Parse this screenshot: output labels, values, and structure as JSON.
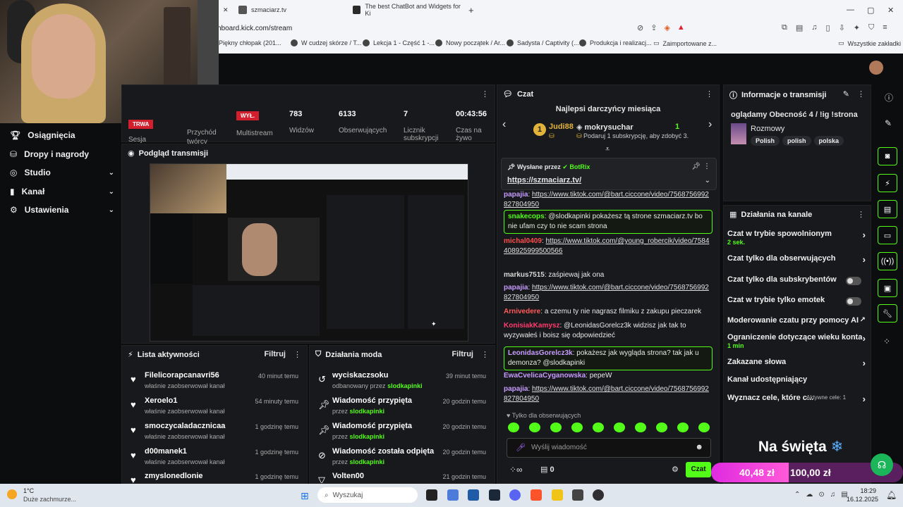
{
  "browser": {
    "tabs": [
      {
        "title": "szmaciarz.tv"
      },
      {
        "title": "The best ChatBot and Widgets for Ki"
      }
    ],
    "url": "hboard.kick.com/stream",
    "bookmarks": [
      "Piękny chłopak (201...",
      "W cudzej skórze / T...",
      "Lekcja 1 - Część 1 -...",
      "Nowy początek / Ar...",
      "Sadysta / Captivity (...",
      "Produkcja i realizacj...",
      "Zaimportowane z...",
      "Wszystkie zakładki"
    ]
  },
  "sidenav": {
    "items": [
      {
        "label": "Osiągnięcia",
        "icon": "trophy-icon"
      },
      {
        "label": "Dropy i nagrody",
        "icon": "gift-icon"
      },
      {
        "label": "Studio",
        "icon": "studio-icon",
        "chevron": "⌄"
      },
      {
        "label": "Kanał",
        "icon": "channel-icon",
        "chevron": "⌄"
      },
      {
        "label": "Ustawienia",
        "icon": "gear-icon",
        "chevron": "⌄"
      }
    ]
  },
  "stats": {
    "live_badge": "TRWA",
    "session_label": "Sesja",
    "revenue_label": "Przychód twórcy",
    "multistream_badge": "WYŁ.",
    "multistream_label": "Multistream",
    "viewers_value": "783",
    "viewers_label": "Widzów",
    "followers_value": "6133",
    "followers_label": "Obserwujących",
    "subs_value": "7",
    "subs_label": "Licznik subskrypcji",
    "time_value": "00:43:56",
    "time_label": "Czas na żywo"
  },
  "preview": {
    "title": "Podgląd transmisji"
  },
  "activity": {
    "title": "Lista aktywności",
    "filter": "Filtruj",
    "items": [
      {
        "name": "Filelicorapcanavri56",
        "desc": "właśnie zaobserwował kanał",
        "time": "40 minut temu"
      },
      {
        "name": "Xeroelo1",
        "desc": "właśnie zaobserwował kanał",
        "time": "54 minuty temu"
      },
      {
        "name": "smoczycaladacznicaa",
        "desc": "właśnie zaobserwował kanał",
        "time": "1 godzinę temu"
      },
      {
        "name": "d00manek1",
        "desc": "właśnie zaobserwował kanał",
        "time": "1 godzinę temu"
      },
      {
        "name": "zmyslonedlonie",
        "desc": "",
        "time": "1 godzinę temu"
      }
    ]
  },
  "modactions": {
    "title": "Działania moda",
    "filter": "Filtruj",
    "items": [
      {
        "name": "wyciskaczsoku",
        "pre": "odbanowany przez",
        "by": "slodkapinki",
        "time": "39 minut temu",
        "icon": "unban-icon"
      },
      {
        "name": "Wiadomość przypięta",
        "pre": "przez",
        "by": "slodkapinki",
        "time": "20 godzin temu",
        "icon": "pin-icon"
      },
      {
        "name": "Wiadomość przypięta",
        "pre": "przez",
        "by": "slodkapinki",
        "time": "20 godzin temu",
        "icon": "pin-icon"
      },
      {
        "name": "Wiadomość została odpięta",
        "pre": "przez",
        "by": "slodkapinki",
        "time": "20 godzin temu",
        "icon": "unpin-icon"
      },
      {
        "name": "Volten00",
        "pre": "",
        "by": "",
        "time": "21 godzin temu",
        "icon": "filter-icon"
      }
    ]
  },
  "chat": {
    "title": "Czat",
    "donors_title": "Najlepsi darczyńcy miesiąca",
    "donor1": "Judi88",
    "donor1_rank": "1",
    "donor2": "mokrysuchar",
    "donor2_count": "1",
    "donor2_sub": "Podaruj 1 subskrypcję, aby zdobyć 3.",
    "pinned_label": "Wysłane przez",
    "pinned_by": "BotRix",
    "pinned_link": "https://szmaciarz.tv/",
    "messages": [
      {
        "user": "papajia",
        "color": "#c79cff",
        "text": "https://www.tiktok.com/@bart.ciccone/video/7568756992827804950",
        "link": true
      },
      {
        "user": "snakecops",
        "color": "#53fc18",
        "text": "@slodkapinki pokażesz tą strone szmaciarz.tv bo nie ufam czy to nie scam strona",
        "hl": true
      },
      {
        "user": "michal0409",
        "color": "#ff4d4d",
        "text": "https://www.tiktok.com/@young_robercik/video/7584408925999500566",
        "link": true
      },
      {
        "user": "markus7515",
        "color": "#d8d8d8",
        "text": "zaśpiewaj jak ona"
      },
      {
        "user": "papajia",
        "color": "#c79cff",
        "text": "https://www.tiktok.com/@bart.ciccone/video/7568756992827804950",
        "link": true
      },
      {
        "user": "Arnivedere",
        "color": "#ff5a5a",
        "text": "a czemu ty nie nagrasz filmiku z zakupu pieczarek"
      },
      {
        "user": "KonisiakKamysz",
        "color": "#ff3c6e",
        "text": "@LeonidasGorelcz3k widzisz jak tak to wyzywałeś i boisz się odpowiedzieć"
      },
      {
        "user": "LeonidasGorelcz3k",
        "color": "#c79cff",
        "text": "pokażesz jak wygląda strona? tak jak u demonza? @slodkapinki",
        "hl": true
      },
      {
        "user": "EwaCvelicaCyganowska",
        "color": "#c79cff",
        "text": "pepeW"
      },
      {
        "user": "papajia",
        "color": "#c79cff",
        "text": "https://www.tiktok.com/@bart.ciccone/video/7568756992827804950",
        "link": true
      }
    ],
    "followers_only": "Tylko dla obserwujących",
    "input_placeholder": "Wyślij wiadomość",
    "points": "0",
    "send_label": "Czat"
  },
  "info": {
    "title": "Informacje o transmisji",
    "stream_title": "oglądamy Obecność 4 / !ig !strona",
    "category": "Rozmowy",
    "tags": [
      "Polish",
      "polish",
      "polska"
    ]
  },
  "channel": {
    "title": "Działania na kanale",
    "items": [
      {
        "label": "Czat w trybie spowolnionym",
        "sub": "2 sek.",
        "ctl": "arrow"
      },
      {
        "label": "Czat tylko dla obserwujących",
        "sub": "",
        "ctl": "arrow"
      },
      {
        "label": "Czat tylko dla subskrybentów",
        "sub": "",
        "ctl": "toggle"
      },
      {
        "label": "Czat w trybie tylko emotek",
        "sub": "",
        "ctl": "toggle"
      },
      {
        "label": "Moderowanie czatu przy pomocy AI",
        "sub": "",
        "ctl": "ext"
      },
      {
        "label": "Ograniczenie dotyczące wieku konta",
        "sub": "1 min",
        "ctl": "arrow"
      },
      {
        "label": "Zakazane słowa",
        "sub": "",
        "ctl": "arrow"
      },
      {
        "label": "Kanał udostępniający",
        "sub": "",
        "ctl": "none"
      },
      {
        "label": "Wyznacz cele, które c...",
        "sub": "",
        "ctl": "arrow",
        "extra": "Aktywne cele: 1"
      }
    ]
  },
  "overlay": {
    "banner": "Na święta",
    "goal_current": "40,48 zł",
    "goal_target": "100,00 zł"
  },
  "taskbar": {
    "weather_temp": "1°C",
    "weather_desc": "Duże zachmurze...",
    "search": "Wyszukaj",
    "time": "18:29",
    "date": "16.12.2025"
  }
}
